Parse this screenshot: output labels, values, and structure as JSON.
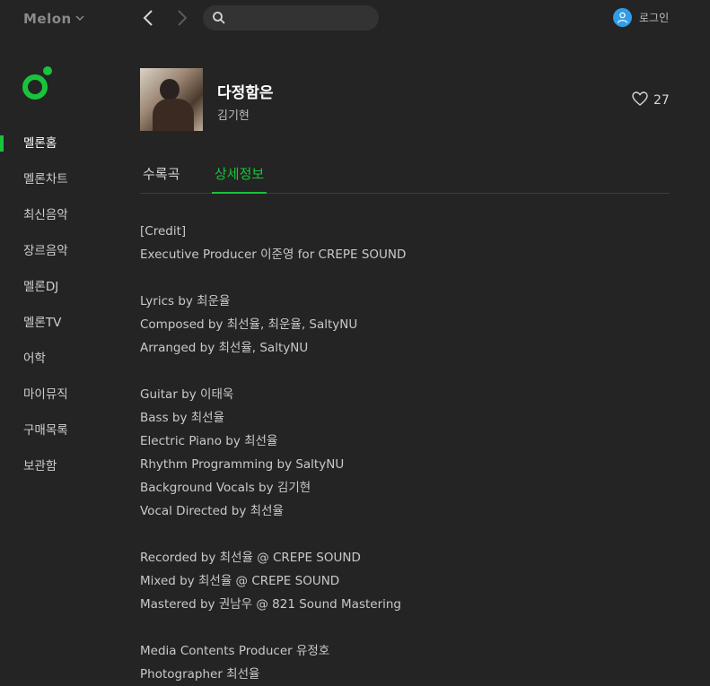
{
  "header": {
    "logo": "Melon",
    "search_placeholder": "",
    "login_label": "로그인"
  },
  "sidebar": {
    "items": [
      {
        "label": "멜론홈"
      },
      {
        "label": "멜론차트"
      },
      {
        "label": "최신음악"
      },
      {
        "label": "장르음악"
      },
      {
        "label": "멜론DJ"
      },
      {
        "label": "멜론TV"
      },
      {
        "label": "어학"
      },
      {
        "label": "마이뮤직"
      },
      {
        "label": "구매목록"
      },
      {
        "label": "보관함"
      }
    ]
  },
  "album": {
    "title": "다정함은",
    "artist": "김기현",
    "likes": "27"
  },
  "tabs": [
    {
      "label": "수록곡"
    },
    {
      "label": "상세정보"
    }
  ],
  "detail_lines": [
    "[Credit]",
    "Executive Producer 이준영 for CREPE SOUND",
    "",
    "Lyrics by 최운율",
    "Composed by 최선율, 최운율, SaltyNU",
    "Arranged by 최선율, SaltyNU",
    "",
    "Guitar by 이태욱",
    "Bass by 최선율",
    "Electric Piano by 최선율",
    "Rhythm Programming by SaltyNU",
    "Background Vocals by 김기현",
    "Vocal Directed by 최선율",
    "",
    "Recorded by 최선율 @ CREPE SOUND",
    "Mixed by 최선율 @ CREPE SOUND",
    "Mastered by 권남우 @ 821 Sound Mastering",
    "",
    "Media Contents Producer 유정호",
    "Photographer 최선율"
  ],
  "colors": {
    "accent": "#19c33b",
    "background": "#242424"
  }
}
